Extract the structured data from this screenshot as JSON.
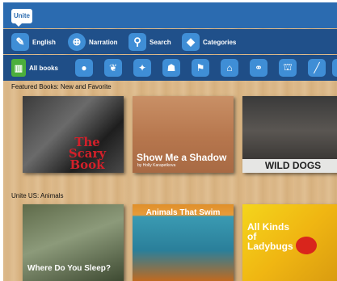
{
  "app": {
    "logo": "Unite"
  },
  "nav": {
    "english": "English",
    "narration": "Narration",
    "search": "Search",
    "categories": "Categories"
  },
  "categories": {
    "all_books": "All books"
  },
  "sections": [
    {
      "title": "Featured Books:  New and Favorite",
      "books": [
        {
          "title": "The Scary Book"
        },
        {
          "title": "Show Me a Shadow",
          "author": "by Holly Karapetkova"
        },
        {
          "title": "WILD DOGS"
        }
      ]
    },
    {
      "title": "Unite US:  Animals",
      "books": [
        {
          "title": "Where Do You Sleep?"
        },
        {
          "title": "Animals That Swim"
        },
        {
          "title": "All Kinds of Ladybugs"
        }
      ]
    }
  ]
}
